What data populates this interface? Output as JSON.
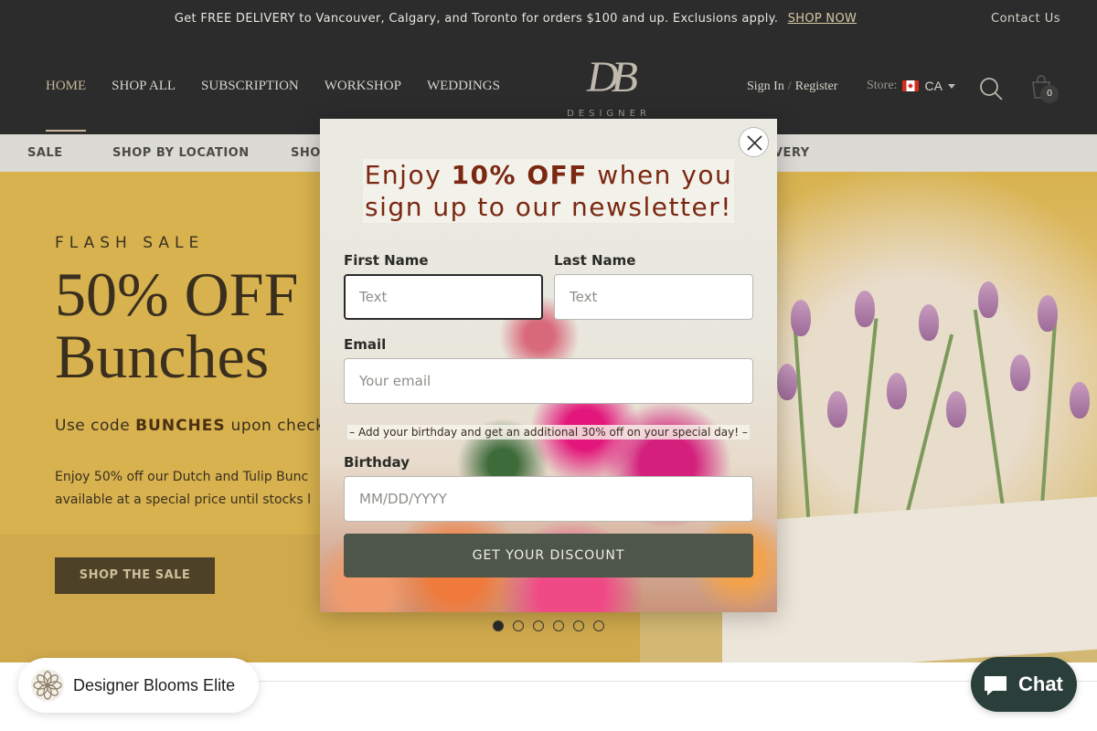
{
  "announcement": {
    "message": "Get FREE DELIVERY to Vancouver, Calgary, and Toronto for orders $100 and up. Exclusions apply.",
    "link_label": "SHOP NOW",
    "contact_label": "Contact Us"
  },
  "header": {
    "nav": [
      "HOME",
      "SHOP ALL",
      "SUBSCRIPTION",
      "WORKSHOP",
      "WEDDINGS"
    ],
    "active_nav": "HOME",
    "logo_mark": "DB",
    "logo_word": "DESIGNER BLOOMS",
    "sign_in": "Sign In",
    "separator": "/",
    "register": "Register",
    "store_label": "Store:",
    "store_code": "CA",
    "cart_count": "0",
    "icons": [
      "search-icon",
      "shopping-bag-icon",
      "canada-flag-icon",
      "chevron-down-icon"
    ]
  },
  "subnav": {
    "items": [
      "SALE",
      "SHOP BY LOCATION",
      "SHOP",
      "VERY"
    ]
  },
  "hero": {
    "eyebrow": "FLASH SALE",
    "headline_line1": "50% OFF",
    "headline_line2": "Bunches",
    "code_prefix": "Use code",
    "code": "BUNCHES",
    "code_suffix": "upon checko",
    "blurb_line1": "Enjoy 50% off our Dutch and Tulip Bunc",
    "blurb_line2": "available at a special price until stocks l",
    "cta": "SHOP THE SALE",
    "slide_count": 6,
    "active_slide": 1,
    "colors": {
      "background": "#d8b24e",
      "button": "#4d4127"
    }
  },
  "modal": {
    "title_part1": "Enjoy ",
    "title_bold": "10% OFF",
    "title_part2": " when you",
    "title_line2": "sign up to our newsletter!",
    "first_name_label": "First Name",
    "first_name_placeholder": "Text",
    "last_name_label": "Last Name",
    "last_name_placeholder": "Text",
    "email_label": "Email",
    "email_placeholder": "Your email",
    "birthday_note": "– Add your birthday and get an additional 30% off on your special day! –",
    "birthday_label": "Birthday",
    "birthday_placeholder": "MM/DD/YYYY",
    "cta": "GET YOUR DISCOUNT",
    "colors": {
      "title": "#7b2812",
      "button": "#4e5649"
    }
  },
  "widgets": {
    "elite_label": "Designer Blooms Elite",
    "chat_label": "Chat"
  }
}
